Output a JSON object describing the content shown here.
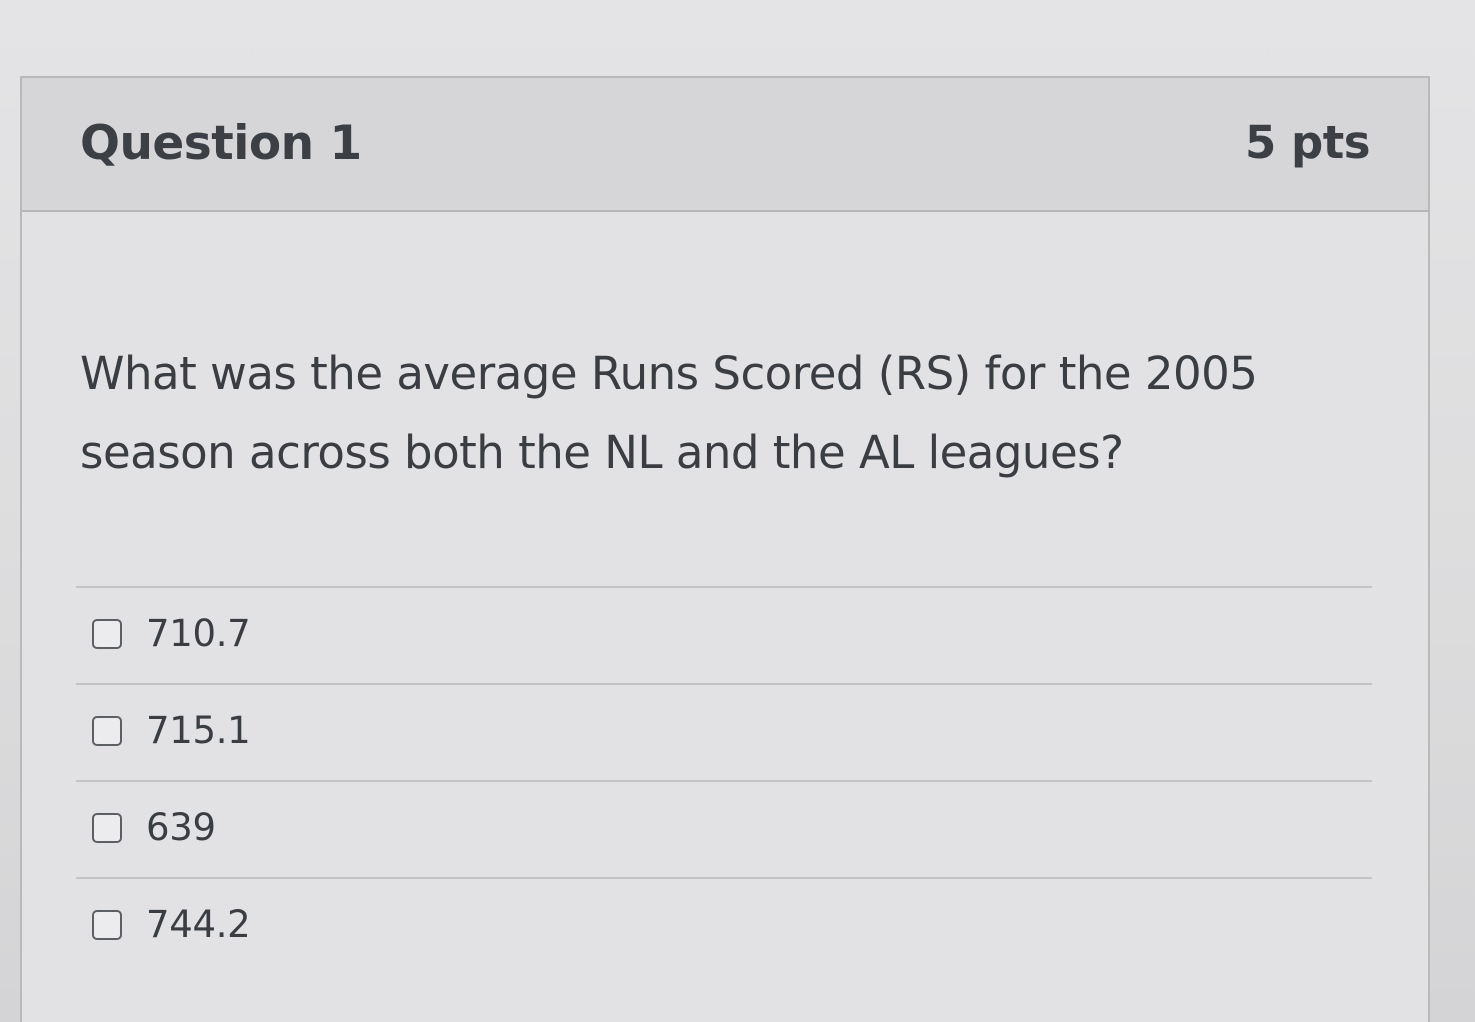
{
  "question": {
    "title": "Question 1",
    "points": "5 pts",
    "text": "What was the average Runs Scored (RS) for the 2005 season across both the NL and the AL leagues?"
  },
  "answers": [
    {
      "label": "710.7",
      "checked": false
    },
    {
      "label": "715.1",
      "checked": false
    },
    {
      "label": "639",
      "checked": false
    },
    {
      "label": "744.2",
      "checked": false
    }
  ]
}
